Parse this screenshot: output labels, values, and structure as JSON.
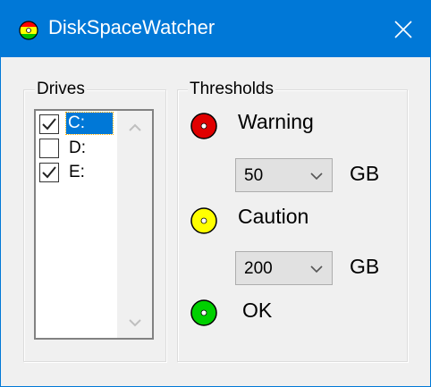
{
  "window": {
    "title": "DiskSpaceWatcher",
    "app_icon": "traffic-light-icon",
    "accent_color": "#0078d7"
  },
  "drives": {
    "group_title": "Drives",
    "items": [
      {
        "label": "C:",
        "checked": true,
        "selected": true
      },
      {
        "label": "D:",
        "checked": false,
        "selected": false
      },
      {
        "label": "E:",
        "checked": true,
        "selected": false
      }
    ]
  },
  "thresholds": {
    "group_title": "Thresholds",
    "warning": {
      "label": "Warning",
      "value": "50",
      "unit": "GB",
      "color": "#e00000"
    },
    "caution": {
      "label": "Caution",
      "value": "200",
      "unit": "GB",
      "color": "#ffff00"
    },
    "ok": {
      "label": "OK",
      "color": "#00d000"
    }
  }
}
